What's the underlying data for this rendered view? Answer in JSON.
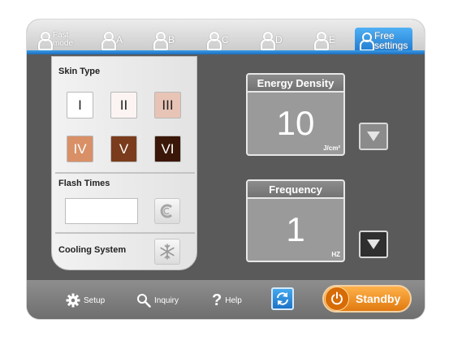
{
  "tabs": [
    {
      "line1": "Fast",
      "line2": "mode"
    },
    {
      "label": "A"
    },
    {
      "label": "B"
    },
    {
      "label": "C"
    },
    {
      "label": "D"
    },
    {
      "label": "E"
    },
    {
      "line1": "Free",
      "line2": "settings",
      "active": true
    }
  ],
  "skin": {
    "title": "Skin Type",
    "types": [
      {
        "label": "I",
        "color": "#ffffff",
        "text": "#222222"
      },
      {
        "label": "II",
        "color": "#fbf4f2",
        "text": "#222222"
      },
      {
        "label": "III",
        "color": "#e8c4b6",
        "text": "#222222"
      },
      {
        "label": "IV",
        "color": "#d99067",
        "text": "#ffffff"
      },
      {
        "label": "V",
        "color": "#7a3c1c",
        "text": "#ffffff"
      },
      {
        "label": "VI",
        "color": "#3a1708",
        "text": "#ffffff"
      }
    ]
  },
  "flash": {
    "title": "Flash Times",
    "value": ""
  },
  "cooling": {
    "title": "Cooling System"
  },
  "energy": {
    "title": "Energy Density",
    "value": "10",
    "unit": "J/cm²"
  },
  "frequency": {
    "title": "Frequency",
    "value": "1",
    "unit": "HZ"
  },
  "bottom": {
    "setup": "Setup",
    "inquiry": "Inquiry",
    "help": "Help",
    "standby": "Standby"
  },
  "colors": {
    "accent_blue": "#1c78cf",
    "standby_orange": "#e07a10"
  }
}
